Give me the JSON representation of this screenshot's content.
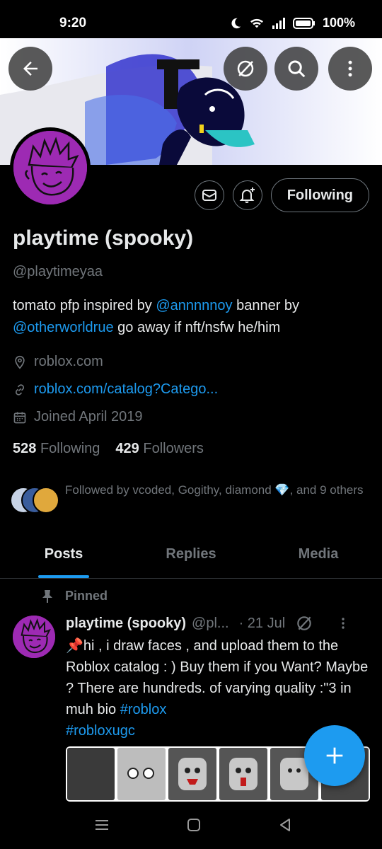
{
  "status": {
    "time": "9:20",
    "battery": "100%"
  },
  "profile": {
    "name": "playtime (spooky)",
    "handle": "@playtimeyaa",
    "bio": {
      "t1": "tomato pfp inspired by ",
      "mention1": "@annnnnoy",
      "t2": " banner by ",
      "mention2": "@otherworldrue",
      "t3": " go away if nft/nsfw he/him"
    },
    "location": "roblox.com",
    "website": "roblox.com/catalog?Catego...",
    "joined": "Joined April 2019",
    "following_count": "528",
    "following_label": "Following",
    "followers_count": "429",
    "followers_label": "Followers",
    "followed_by": "Followed by vcoded, Gogithy, diamond 💎, and 9 others",
    "follow_button": "Following"
  },
  "tabs": [
    {
      "label": "Posts",
      "active": true
    },
    {
      "label": "Replies",
      "active": false
    },
    {
      "label": "Media",
      "active": false
    }
  ],
  "tweet": {
    "pinned_label": "Pinned",
    "name": "playtime (spooky)",
    "handle": "@pl...",
    "date": "· 21 Jul",
    "text": "📌hi , i draw faces , and upload them to the Roblox catalog : ) Buy them if you Want? Maybe ? There are hundreds. of varying quality :\"3 in muh bio ",
    "hashtag1": "#roblox",
    "hashtag2": "#robloxugc"
  },
  "icons": {
    "back": "back-arrow-icon",
    "mute": "mute-icon",
    "search": "search-icon",
    "more": "more-vertical-icon",
    "message": "message-icon",
    "notify": "notification-bell-icon",
    "location": "location-pin-icon",
    "link": "link-icon",
    "calendar": "calendar-icon",
    "pin": "pin-icon",
    "compose": "plus-icon"
  },
  "colors": {
    "accent": "#1d9bf0",
    "avatar_bg": "#9d2ab3",
    "background": "#000000",
    "muted": "#71767b"
  }
}
